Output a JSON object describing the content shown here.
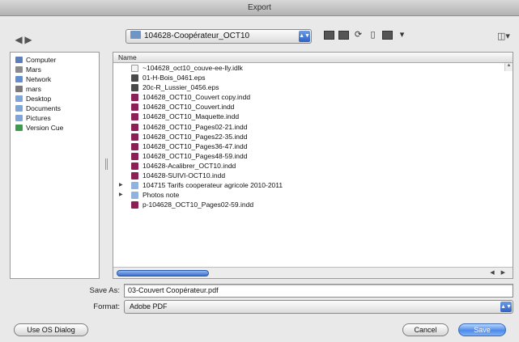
{
  "window": {
    "title": "Export"
  },
  "toolbar": {
    "back_glyph": "◀",
    "forward_glyph": "▶",
    "path_folder": "104628-Coopérateur_OCT10",
    "path_arrows": "▲▼",
    "icons": [
      "icon-view-icon",
      "list-view-icon",
      "column-view-icon",
      "new-folder-icon",
      "trash-icon",
      "action-menu-icon"
    ],
    "view_menu_glyph": "◫▾"
  },
  "sidebar": {
    "items": [
      {
        "label": "Computer",
        "icon": "computer-icon",
        "color": "#5c7fb8"
      },
      {
        "label": "Mars",
        "icon": "hard-drive-icon",
        "color": "#8a8a8a"
      },
      {
        "label": "Network",
        "icon": "network-icon",
        "color": "#5f8fd0"
      },
      {
        "label": "mars",
        "icon": "home-icon",
        "color": "#7a7a7a"
      },
      {
        "label": "Desktop",
        "icon": "desktop-folder-icon",
        "color": "#7fa4d8"
      },
      {
        "label": "Documents",
        "icon": "documents-folder-icon",
        "color": "#7fa4d8"
      },
      {
        "label": "Pictures",
        "icon": "pictures-folder-icon",
        "color": "#7fa4d8"
      },
      {
        "label": "Version Cue",
        "icon": "version-cue-icon",
        "color": "#3e9a4c"
      }
    ]
  },
  "filelist": {
    "column_header": "Name",
    "sort_glyph": "▲",
    "rows": [
      {
        "label": "~104628_oct10_couve-ee-lly.idlk",
        "type": "idlk",
        "tri": ""
      },
      {
        "label": "01-H-Bois_0461.eps",
        "type": "eps",
        "tri": ""
      },
      {
        "label": "20c-R_Lussier_0456.eps",
        "type": "eps",
        "tri": ""
      },
      {
        "label": "104628_OCT10_Couvert copy.indd",
        "type": "indd",
        "tri": ""
      },
      {
        "label": "104628_OCT10_Couvert.indd",
        "type": "indd",
        "tri": ""
      },
      {
        "label": "104628_OCT10_Maquette.indd",
        "type": "indd",
        "tri": ""
      },
      {
        "label": "104628_OCT10_Pages02-21.indd",
        "type": "indd",
        "tri": ""
      },
      {
        "label": "104628_OCT10_Pages22-35.indd",
        "type": "indd",
        "tri": ""
      },
      {
        "label": "104628_OCT10_Pages36-47.indd",
        "type": "indd",
        "tri": ""
      },
      {
        "label": "104628_OCT10_Pages48-59.indd",
        "type": "indd",
        "tri": ""
      },
      {
        "label": "104628-Acalibrer_OCT10.indd",
        "type": "indd",
        "tri": ""
      },
      {
        "label": "104628-SUIVI-OCT10.indd",
        "type": "indd",
        "tri": ""
      },
      {
        "label": "104715 Tarifs cooperateur agricole 2010-2011",
        "type": "folder",
        "tri": "▶"
      },
      {
        "label": "Photos note",
        "type": "folder",
        "tri": "▶"
      },
      {
        "label": "p-104628_OCT10_Pages02-59.indd",
        "type": "indd",
        "tri": ""
      }
    ],
    "scroll_arrows": "◀ ▶",
    "scroll_up_glyph": "▲"
  },
  "form": {
    "save_as_label": "Save As:",
    "save_as_value": "03-Couvert Coopérateur.pdf",
    "format_label": "Format:",
    "format_value": "Adobe PDF",
    "format_arrows": "▲▼"
  },
  "buttons": {
    "use_os_dialog": "Use OS Dialog",
    "cancel": "Cancel",
    "save": "Save"
  }
}
